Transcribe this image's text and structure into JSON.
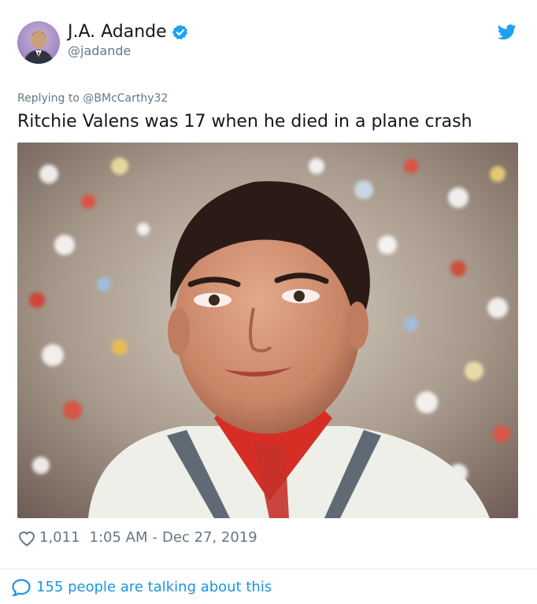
{
  "author": {
    "display_name": "J.A. Adande",
    "handle": "@jadande",
    "verified_icon": "verified-badge-icon",
    "avatar_icon": "avatar"
  },
  "reply": {
    "prefix": "Replying to",
    "mention": "@BMcCarthy32"
  },
  "tweet": {
    "text": "Ritchie Valens was 17 when he died in a plane crash"
  },
  "meta": {
    "likes": "1,011",
    "time": "1:05 AM",
    "separator": "-",
    "date": "Dec 27, 2019"
  },
  "conversation": {
    "label": "155 people are talking about this"
  },
  "colors": {
    "brand_blue": "#1da1f2",
    "link_blue": "#1b95e0",
    "muted_gray": "#657786",
    "text_dark": "#14171a"
  },
  "icons": {
    "logo": "twitter-bird-icon",
    "like": "heart-icon",
    "reply": "chat-bubble-icon"
  }
}
